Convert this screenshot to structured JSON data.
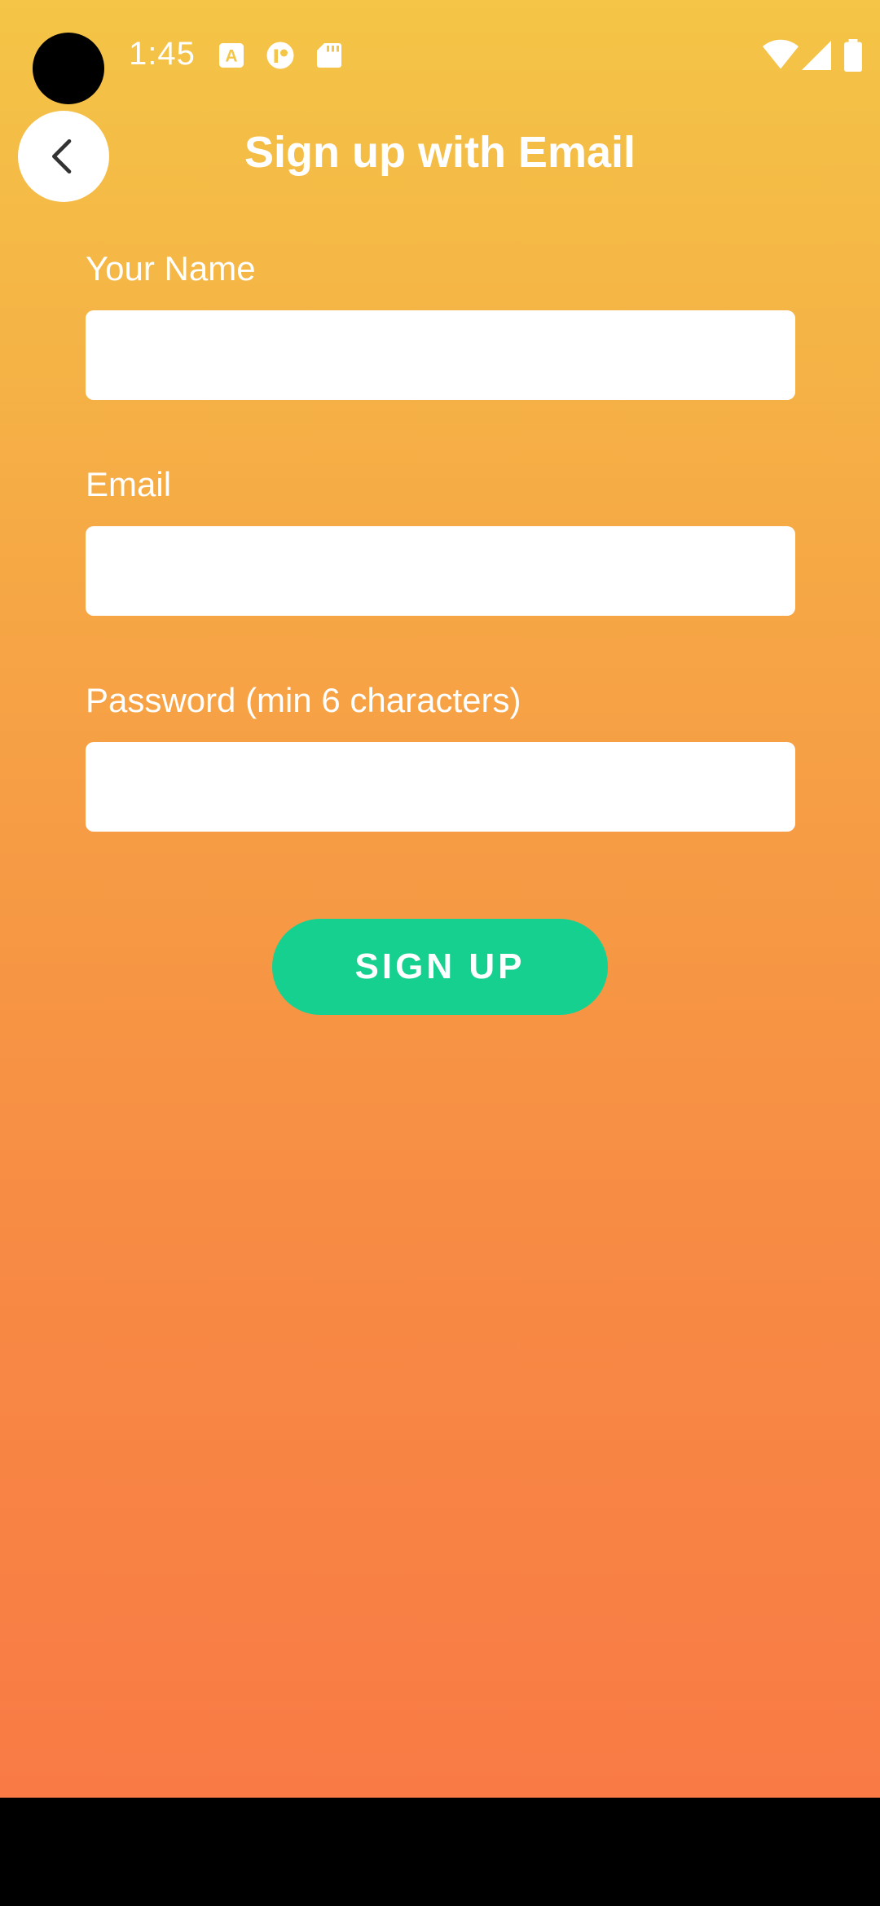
{
  "status_bar": {
    "time": "1:45",
    "icons": [
      "translate-icon",
      "app-notification-icon",
      "sd-card-icon",
      "wifi-icon",
      "signal-icon",
      "battery-icon"
    ]
  },
  "header": {
    "title": "Sign up with Email",
    "back_icon": "chevron-left-icon"
  },
  "form": {
    "name_label": "Your Name",
    "name_value": "",
    "email_label": "Email",
    "email_value": "",
    "password_label": "Password (min 6 characters)",
    "password_value": "",
    "submit_label": "SIGN UP"
  },
  "colors": {
    "gradient_top": "#F4C546",
    "gradient_bottom": "#F97A45",
    "button": "#15D08F",
    "text": "#FFFFFF"
  }
}
